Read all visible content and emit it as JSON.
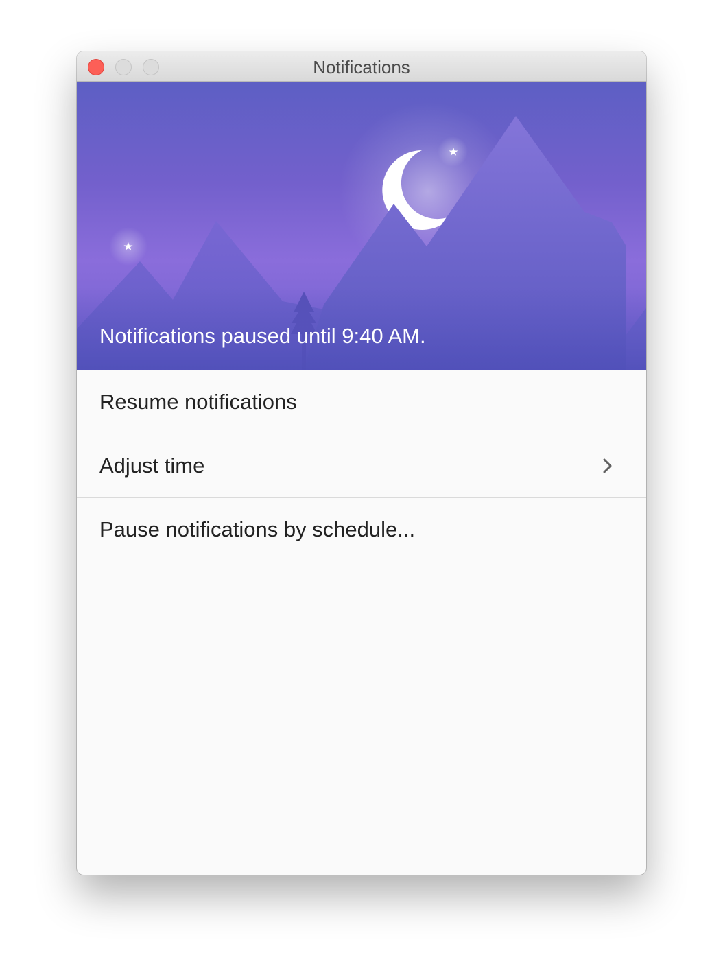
{
  "window": {
    "title": "Notifications"
  },
  "hero": {
    "status_text": "Notifications paused until 9:40 AM."
  },
  "menu": {
    "items": [
      {
        "label": "Resume notifications",
        "has_chevron": false
      },
      {
        "label": "Adjust time",
        "has_chevron": true,
        "icon": "chevron-right-icon"
      },
      {
        "label": "Pause notifications by schedule...",
        "has_chevron": false
      }
    ]
  },
  "colors": {
    "close_button": "#fc5f57",
    "hero_top": "#5d5fc4",
    "hero_mid": "#8a6ddb",
    "moon": "#ffffff"
  }
}
